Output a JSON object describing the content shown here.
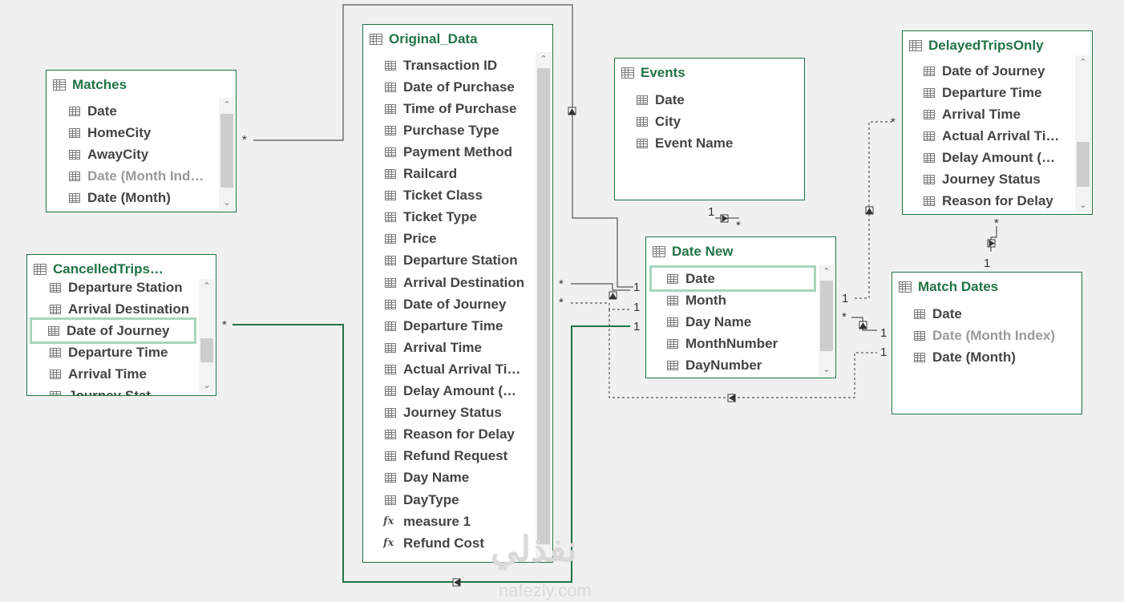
{
  "tables": {
    "matches": {
      "title": "Matches",
      "columns": [
        "Date",
        "HomeCity",
        "AwayCity",
        "Date (Month Ind…",
        "Date (Month)"
      ]
    },
    "cancelled": {
      "title": "CancelledTrips…",
      "columns": [
        "Departure Station",
        "Arrival Destination",
        "Date of Journey",
        "Departure Time",
        "Arrival Time",
        "Journey Stat…"
      ]
    },
    "original": {
      "title": "Original_Data",
      "columns": [
        "Transaction ID",
        "Date of Purchase",
        "Time of Purchase",
        "Purchase Type",
        "Payment Method",
        "Railcard",
        "Ticket Class",
        "Ticket Type",
        "Price",
        "Departure Station",
        "Arrival Destination",
        "Date of Journey",
        "Departure Time",
        "Arrival Time",
        "Actual Arrival Ti…",
        "Delay Amount (…",
        "Journey Status",
        "Reason for Delay",
        "Refund Request",
        "Day Name",
        "DayType"
      ],
      "measures": [
        "measure 1",
        "Refund Cost"
      ]
    },
    "events": {
      "title": "Events",
      "columns": [
        "Date",
        "City",
        "Event Name"
      ]
    },
    "datenew": {
      "title": "Date New",
      "columns": [
        "Date",
        "Month",
        "Day Name",
        "MonthNumber",
        "DayNumber"
      ]
    },
    "delayed": {
      "title": "DelayedTripsOnly",
      "columns": [
        "Date of Journey",
        "Departure Time",
        "Arrival Time",
        "Actual Arrival Ti…",
        "Delay Amount (…",
        "Journey Status",
        "Reason for Delay"
      ]
    },
    "matchdates": {
      "title": "Match Dates",
      "columns": [
        "Date",
        "Date (Month Index)",
        "Date (Month)"
      ]
    }
  },
  "cardinality": {
    "one": "1",
    "many": "*"
  },
  "measure_icon": "fx",
  "watermark": {
    "arabic": "نفذلي",
    "latin": "nafezly.com"
  }
}
